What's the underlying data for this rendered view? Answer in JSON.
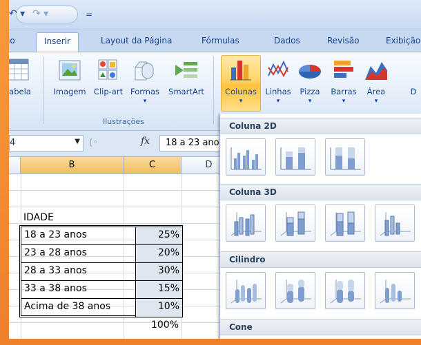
{
  "qat": {
    "undo_icon": "undo-icon",
    "redo_icon": "redo-icon",
    "customize": "="
  },
  "tabs": [
    {
      "label": "io",
      "active": false
    },
    {
      "label": "Inserir",
      "active": true
    },
    {
      "label": "Layout da Página",
      "active": false
    },
    {
      "label": "Fórmulas",
      "active": false
    },
    {
      "label": "Dados",
      "active": false
    },
    {
      "label": "Revisão",
      "active": false
    },
    {
      "label": "Exibição",
      "active": false
    }
  ],
  "ribbon": {
    "tabela": "abela",
    "imagem": "Imagem",
    "clipart": "Clip-art",
    "formas": "Formas",
    "smartart": "SmartArt",
    "ilustracoes": "Ilustrações",
    "colunas": "Colunas",
    "linhas": "Linhas",
    "pizza": "Pizza",
    "barras": "Barras",
    "area": "Área",
    "dispersao": "D",
    "dropdown_glyph": "▾"
  },
  "formula_bar": {
    "name_box": "4",
    "fx": "fx",
    "content": "18 a 23 anos"
  },
  "columns": {
    "b": "B",
    "c": "C",
    "d": "D"
  },
  "sheet": {
    "header": "IDADE",
    "rows": [
      {
        "label": "18 a 23 anos",
        "value": "25%"
      },
      {
        "label": "23 a 28 anos",
        "value": "20%"
      },
      {
        "label": "28 a 33 anos",
        "value": "30%"
      },
      {
        "label": "33 a 38 anos",
        "value": "15%"
      },
      {
        "label": "Acima de 38 anos",
        "value": "10%"
      }
    ],
    "total": "100%"
  },
  "gallery": {
    "sections": [
      "Coluna 2D",
      "Coluna 3D",
      "Cilindro",
      "Cone"
    ]
  },
  "colors": {
    "accent": "#f4933b",
    "ribbon_blue": "#c6d9f1",
    "highlight": "#ffd467",
    "selected_cells": "#dee6f0"
  }
}
